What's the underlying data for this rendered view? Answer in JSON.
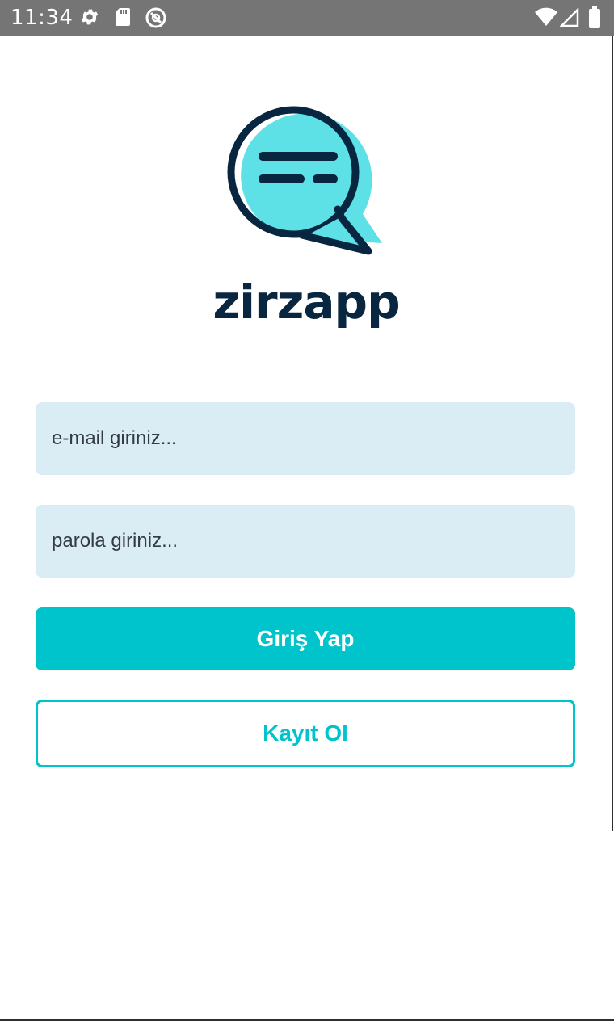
{
  "status_bar": {
    "time": "11:34",
    "left_icons": [
      "gear-icon",
      "sd-card-icon",
      "data-saver-icon"
    ],
    "right_icons": [
      "wifi-icon",
      "cell-signal-icon",
      "battery-icon"
    ]
  },
  "logo": {
    "icon": "chat-bubble-icon",
    "text": "zirzapp",
    "colors": {
      "bubble_fill": "#5de1e7",
      "outline": "#082640"
    }
  },
  "login_form": {
    "email_placeholder": "e-mail giriniz...",
    "password_placeholder": "parola giriniz...",
    "login_button_label": "Giriş Yap",
    "register_button_label": "Kayıt Ol"
  },
  "colors": {
    "accent": "#00c4cc",
    "input_background": "#daecf4",
    "status_bar": "#757575"
  }
}
